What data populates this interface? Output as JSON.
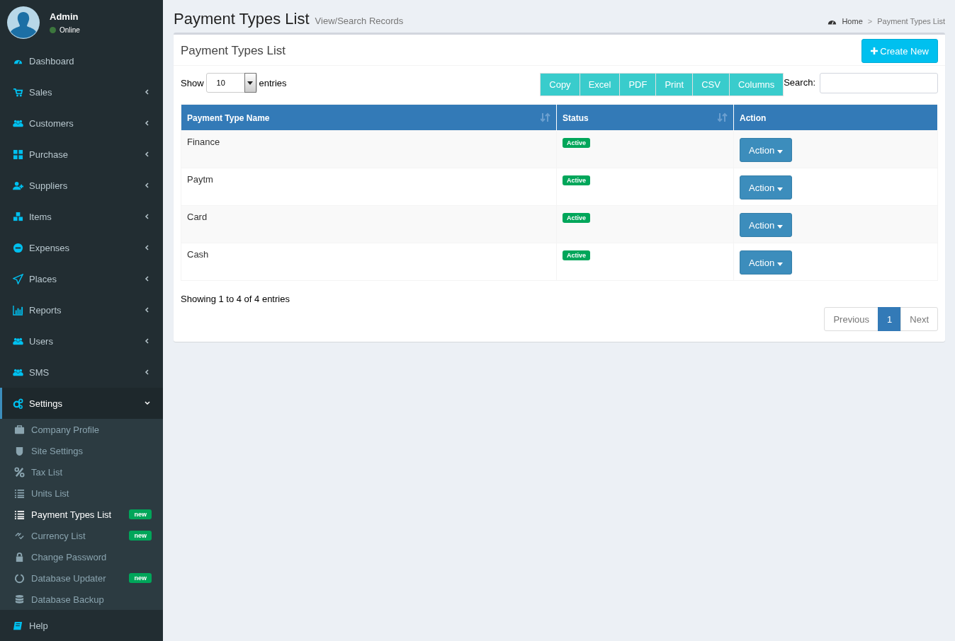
{
  "user": {
    "name": "Admin",
    "status": "Online",
    "online": true
  },
  "sidebar": {
    "items": [
      {
        "kind": "link",
        "label": "Dashboard",
        "selected": false
      },
      {
        "kind": "tree",
        "label": "Sales",
        "expanded": false,
        "selected": false
      },
      {
        "kind": "tree",
        "label": "Customers",
        "expanded": false,
        "selected": false
      },
      {
        "kind": "tree",
        "label": "Purchase",
        "expanded": false,
        "selected": false
      },
      {
        "kind": "tree",
        "label": "Suppliers",
        "expanded": false,
        "selected": false
      },
      {
        "kind": "tree",
        "label": "Items",
        "expanded": false,
        "selected": false
      },
      {
        "kind": "tree",
        "label": "Expenses",
        "expanded": false,
        "selected": false
      },
      {
        "kind": "tree",
        "label": "Places",
        "expanded": false,
        "selected": false
      },
      {
        "kind": "tree",
        "label": "Reports",
        "expanded": false,
        "selected": false
      },
      {
        "kind": "tree",
        "label": "Users",
        "expanded": false,
        "selected": false
      },
      {
        "kind": "tree",
        "label": "SMS",
        "expanded": false,
        "selected": false
      },
      {
        "kind": "tree",
        "label": "Settings",
        "expanded": true,
        "selected": true,
        "children": [
          {
            "label": "Company Profile",
            "selected": false
          },
          {
            "label": "Site Settings",
            "selected": false
          },
          {
            "label": "Tax List",
            "selected": false
          },
          {
            "label": "Units List",
            "selected": false
          },
          {
            "label": "Payment Types List",
            "selected": true,
            "badge": "new"
          },
          {
            "label": "Currency List",
            "selected": false,
            "badge": "new"
          },
          {
            "label": "Change Password",
            "selected": false
          },
          {
            "label": "Database Updater",
            "selected": false,
            "badge": "new"
          },
          {
            "label": "Database Backup",
            "selected": false
          }
        ]
      },
      {
        "kind": "link",
        "label": "Help",
        "selected": false
      }
    ]
  },
  "page": {
    "title": "Payment Types List",
    "subtitle": "View/Search Records",
    "breadcrumb": [
      "Home",
      "Payment Types List"
    ],
    "breadcrumb_separator": ">"
  },
  "box": {
    "title": "Payment Types List",
    "create_button": "Create New",
    "length": {
      "before": "Show",
      "value": "10",
      "after": "entries"
    },
    "export_buttons": [
      "Copy",
      "Excel",
      "PDF",
      "Print",
      "CSV",
      "Columns"
    ],
    "search": {
      "label": "Search:"
    },
    "table": {
      "columns": [
        {
          "label": "Payment Type Name",
          "sortable": true
        },
        {
          "label": "Status",
          "sortable": true
        },
        {
          "label": "Action",
          "sortable": false
        }
      ],
      "rows": [
        {
          "name": "Finance",
          "status": "Active",
          "action": "Action"
        },
        {
          "name": "Paytm",
          "status": "Active",
          "action": "Action"
        },
        {
          "name": "Card",
          "status": "Active",
          "action": "Action"
        },
        {
          "name": "Cash",
          "status": "Active",
          "action": "Action"
        }
      ]
    },
    "info": "Showing 1 to 4 of 4 entries",
    "pagination": [
      {
        "label": "Previous",
        "selected": false
      },
      {
        "label": "1",
        "selected": true
      },
      {
        "label": "Next",
        "selected": false
      }
    ]
  }
}
